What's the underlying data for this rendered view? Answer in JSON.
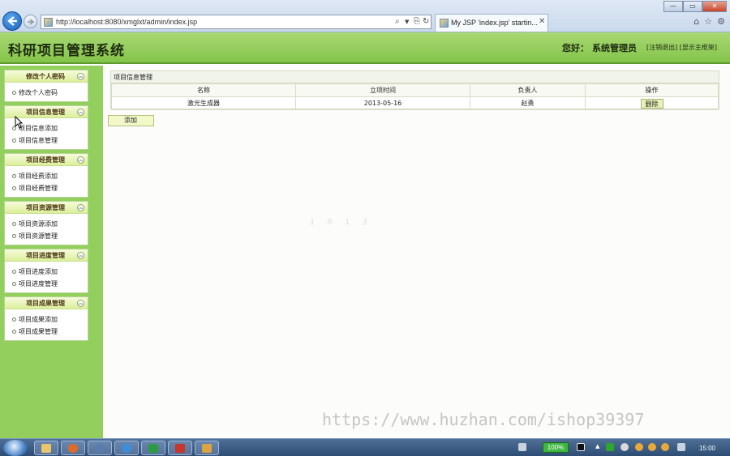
{
  "browser": {
    "url": "http://localhost:8080/xmglxt/admin/index.jsp",
    "tab_title": "My JSP 'index.jsp' startin...",
    "win_minimize": "—",
    "win_restore": "▭",
    "win_close": "✕"
  },
  "header": {
    "title": "科研项目管理系统",
    "greeting": "您好：",
    "user": "系统管理员",
    "logout": "[注销退出]",
    "home": "[显示主框架]"
  },
  "sidebar": {
    "groups": [
      {
        "title": "修改个人密码",
        "items": [
          "修改个人密码"
        ]
      },
      {
        "title": "项目信息管理",
        "items": [
          "项目信息添加",
          "项目信息管理"
        ]
      },
      {
        "title": "项目经费管理",
        "items": [
          "项目经费添加",
          "项目经费管理"
        ]
      },
      {
        "title": "项目资源管理",
        "items": [
          "项目资源添加",
          "项目资源管理"
        ]
      },
      {
        "title": "项目进度管理",
        "items": [
          "项目进度添加",
          "项目进度管理"
        ]
      },
      {
        "title": "项目成果管理",
        "items": [
          "项目成果添加",
          "项目成果管理"
        ]
      }
    ]
  },
  "main": {
    "panel_title": "项目信息管理",
    "columns": [
      "名称",
      "立项时间",
      "负责人",
      "操作"
    ],
    "rows": [
      {
        "name": "激光生成器",
        "date": "2013-05-16",
        "owner": "赵勇",
        "action": "删除"
      }
    ],
    "add_label": "添加",
    "faint_text": "1 8 1 3",
    "watermark": "https://www.huzhan.com/ishop39397"
  },
  "taskbar": {
    "battery": "100%",
    "clock": "15:00"
  },
  "colors": {
    "header_green": "#a8d874",
    "sidebar_green": "#93cf5c",
    "menu_head": "#dcef9c",
    "button_yellow": "#f3f8c8"
  }
}
